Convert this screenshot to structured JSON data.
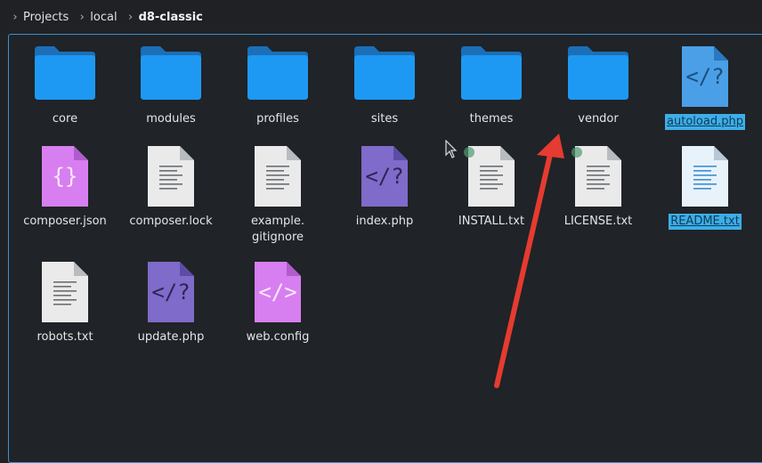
{
  "breadcrumb": [
    {
      "label": "Projects"
    },
    {
      "label": "local"
    },
    {
      "label": "d8-classic"
    }
  ],
  "colors": {
    "accent": "#3daee9",
    "folder": "#1d99f3",
    "php": "#7f6bc9",
    "json": "#d77ff0",
    "text_file": "#eaeaea",
    "annotation_arrow": "#e53b30"
  },
  "items": [
    {
      "name": "core",
      "type": "folder",
      "icon": "folder-icon"
    },
    {
      "name": "modules",
      "type": "folder",
      "icon": "folder-icon"
    },
    {
      "name": "profiles",
      "type": "folder",
      "icon": "folder-icon"
    },
    {
      "name": "sites",
      "type": "folder",
      "icon": "folder-icon"
    },
    {
      "name": "themes",
      "type": "folder",
      "icon": "folder-icon"
    },
    {
      "name": "vendor",
      "type": "folder",
      "icon": "folder-icon"
    },
    {
      "name": "autoload.php",
      "type": "php-blue",
      "icon": "php-file-icon",
      "selected": true
    },
    {
      "name": "composer.json",
      "type": "json",
      "icon": "json-file-icon"
    },
    {
      "name": "composer.lock",
      "type": "text",
      "icon": "text-file-icon"
    },
    {
      "name": "example.\ngitignore",
      "type": "text",
      "icon": "text-file-icon"
    },
    {
      "name": "index.php",
      "type": "php",
      "icon": "php-file-icon"
    },
    {
      "name": "INSTALL.txt",
      "type": "text",
      "icon": "text-file-icon"
    },
    {
      "name": "LICENSE.txt",
      "type": "text",
      "icon": "text-file-icon"
    },
    {
      "name": "README.txt",
      "type": "text-blue",
      "icon": "text-file-icon",
      "selected": true
    },
    {
      "name": "robots.txt",
      "type": "text",
      "icon": "text-file-icon"
    },
    {
      "name": "update.php",
      "type": "php",
      "icon": "php-file-icon"
    },
    {
      "name": "web.config",
      "type": "xml",
      "icon": "xml-file-icon"
    }
  ]
}
